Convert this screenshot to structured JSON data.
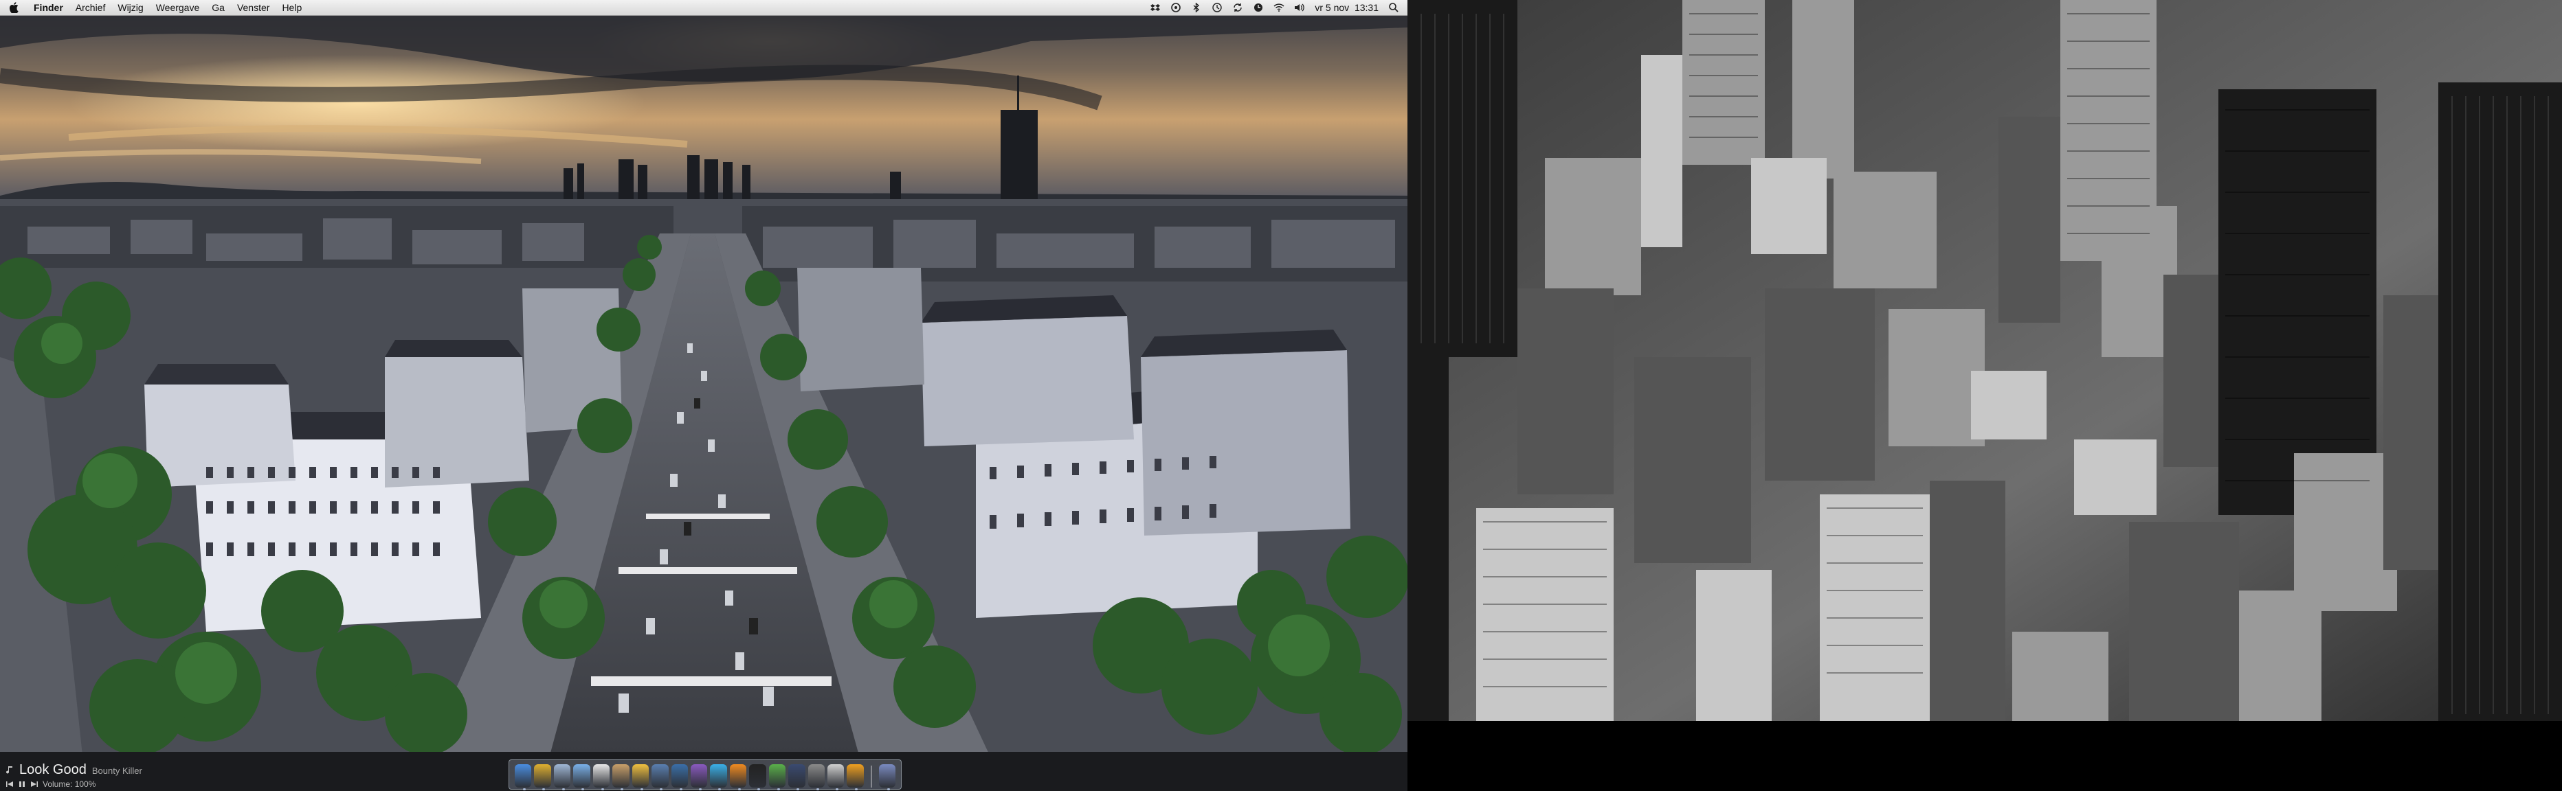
{
  "menubar": {
    "app_name": "Finder",
    "menus": [
      "Archief",
      "Wijzig",
      "Weergave",
      "Ga",
      "Venster",
      "Help"
    ],
    "clock": "vr 5 nov  13:31"
  },
  "now_playing": {
    "title": "Look Good",
    "artist": "Bounty Killer",
    "volume": "Volume: 100%"
  },
  "dock": {
    "items": [
      {
        "icon": "finder-icon",
        "color": "#4a8de0"
      },
      {
        "icon": "chrome-icon",
        "color": "#e0b030"
      },
      {
        "icon": "mail-icon",
        "color": "#9fb7d6"
      },
      {
        "icon": "itunes-icon",
        "color": "#7ab0e8"
      },
      {
        "icon": "ical-icon",
        "color": "#e8e8e8"
      },
      {
        "icon": "address-book-icon",
        "color": "#c9a06a"
      },
      {
        "icon": "adium-icon",
        "color": "#f0c040"
      },
      {
        "icon": "xcode-icon",
        "color": "#5a7fb0"
      },
      {
        "icon": "photoshop-icon",
        "color": "#3a6fa8"
      },
      {
        "icon": "textmate-icon",
        "color": "#8a5ac0"
      },
      {
        "icon": "skype-icon",
        "color": "#3ab0e8"
      },
      {
        "icon": "vlc-icon",
        "color": "#f08a20"
      },
      {
        "icon": "terminal-icon",
        "color": "#222222"
      },
      {
        "icon": "activity-monitor-icon",
        "color": "#5ab04a"
      },
      {
        "icon": "dashboard-icon",
        "color": "#3a4a70"
      },
      {
        "icon": "system-preferences-icon",
        "color": "#8a8a8a"
      },
      {
        "icon": "script-editor-icon",
        "color": "#d0d0d0"
      },
      {
        "icon": "vlc-cone-icon",
        "color": "#f0a020"
      }
    ],
    "trailing": [
      {
        "icon": "downloads-stack-icon",
        "color": "#7a8ac0"
      }
    ]
  }
}
